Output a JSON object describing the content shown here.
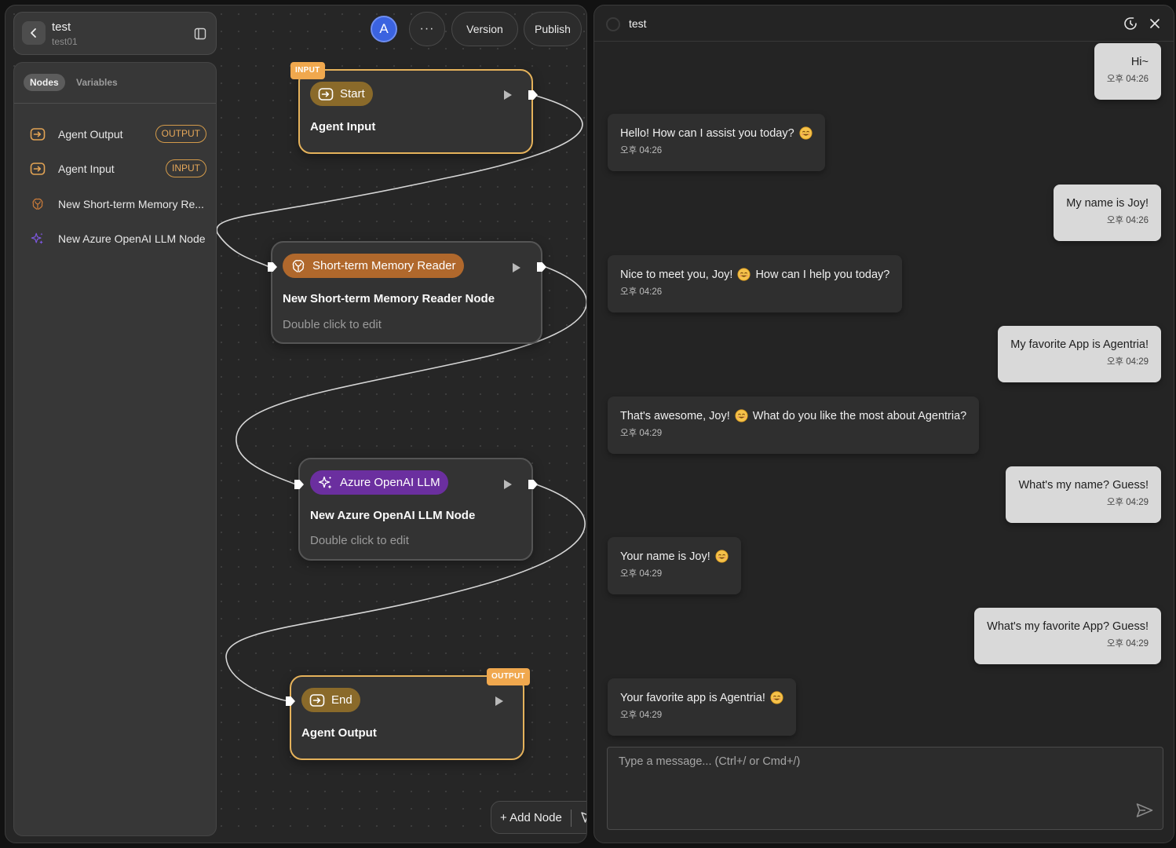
{
  "project": {
    "name": "test",
    "subtitle": "test01"
  },
  "sidebar": {
    "tabs": [
      {
        "label": "Nodes"
      },
      {
        "label": "Variables"
      }
    ],
    "items": [
      {
        "label": "Agent Output",
        "badge": "OUTPUT",
        "icon": "arrow-box-icon"
      },
      {
        "label": "Agent Input",
        "badge": "INPUT",
        "icon": "arrow-box-icon"
      },
      {
        "label": "New Short-term Memory Re...",
        "icon": "brain-icon"
      },
      {
        "label": "New Azure OpenAI LLM Node",
        "icon": "sparkle-icon"
      }
    ]
  },
  "toolbar": {
    "avatar_letter": "A",
    "more_label": "···",
    "version_label": "Version",
    "publish_label": "Publish"
  },
  "nodes": {
    "start": {
      "tag": "INPUT",
      "chip": "Start",
      "title": "Agent Input"
    },
    "memory": {
      "chip": "Short-term Memory Reader",
      "title": "New Short-term Memory Reader Node",
      "hint": "Double click to edit"
    },
    "llm": {
      "chip": "Azure OpenAI LLM",
      "title": "New Azure OpenAI LLM Node",
      "hint": "Double click to edit"
    },
    "end": {
      "tag": "OUTPUT",
      "chip": "End",
      "title": "Agent Output"
    }
  },
  "add_node_label": "+ Add Node",
  "colors": {
    "io_border": "#e5b25b",
    "memory_chip": "#b0682c",
    "llm_chip": "#6b2f9f",
    "io_chip": "#8a6a2a",
    "avatar": "#3b63e0"
  },
  "chat": {
    "title": "test",
    "messages": [
      {
        "role": "user",
        "text": "Hi~",
        "time": "오후 04:26"
      },
      {
        "role": "bot",
        "text": "Hello! How can I assist you today?",
        "time": "오후 04:26"
      },
      {
        "role": "user",
        "text": "My name is Joy!",
        "time": "오후 04:26"
      },
      {
        "role": "bot",
        "text_before": "Nice to meet you, Joy!",
        "text_after": "How can I help you today?",
        "time": "오후 04:26"
      },
      {
        "role": "user",
        "text": "My favorite App is Agentria!",
        "time": "오후 04:29"
      },
      {
        "role": "bot",
        "text_before": "That's awesome, Joy!",
        "text_after": "What do you like the most about Agentria?",
        "time": "오후 04:29"
      },
      {
        "role": "user",
        "text": "What's my name? Guess!",
        "time": "오후 04:29"
      },
      {
        "role": "bot",
        "text": "Your name is Joy!",
        "time": "오후 04:29"
      },
      {
        "role": "user",
        "text": "What's my favorite App? Guess!",
        "time": "오후 04:29"
      },
      {
        "role": "bot",
        "text": "Your favorite app is Agentria!",
        "time": "오후 04:29"
      }
    ],
    "input_placeholder": "Type a message... (Ctrl+/ or Cmd+/)"
  }
}
